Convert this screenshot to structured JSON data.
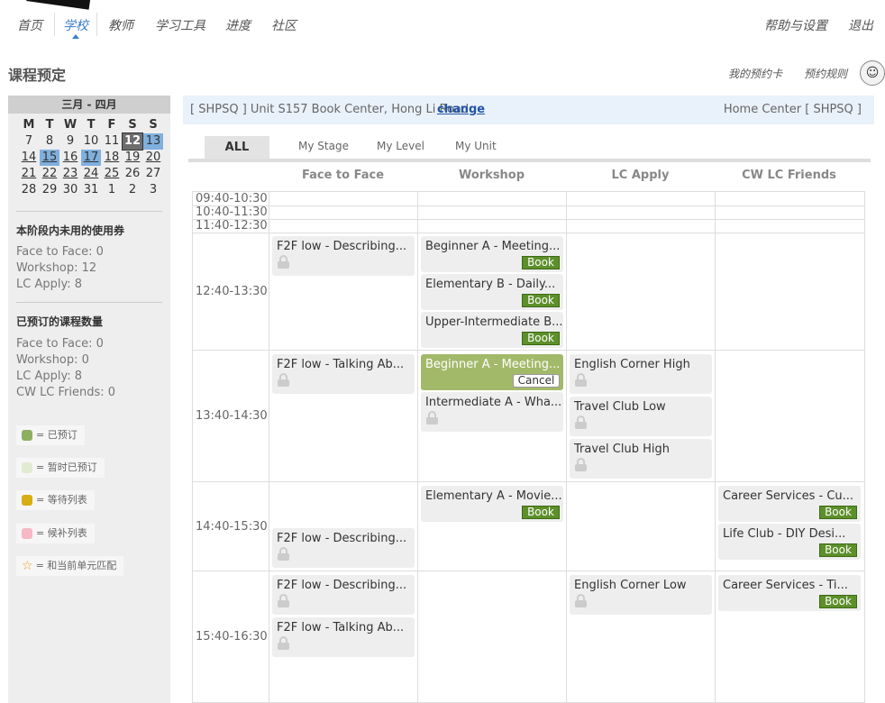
{
  "nav": {
    "items": [
      "首页",
      "学校",
      "教师",
      "学习工具",
      "进度",
      "社区"
    ],
    "help": "帮助与设置",
    "logout": "退出"
  },
  "page": {
    "title": "课程预定",
    "my_card": "我的预约卡",
    "rules": "预约规则"
  },
  "calendar": {
    "header": "三月 - 四月",
    "dows": [
      "M",
      "T",
      "W",
      "T",
      "F",
      "S",
      "S"
    ],
    "rows": [
      [
        "7",
        "8",
        "9",
        "10",
        "11",
        "12",
        "13"
      ],
      [
        "14",
        "15",
        "16",
        "17",
        "18",
        "19",
        "20"
      ],
      [
        "21",
        "22",
        "23",
        "24",
        "25",
        "26",
        "27"
      ],
      [
        "28",
        "29",
        "30",
        "31",
        "1",
        "2",
        "3"
      ]
    ]
  },
  "sidebar": {
    "unused_title": "本阶段内未用的使用券",
    "unused": [
      "Face to Face: 0",
      "Workshop: 12",
      "LC Apply: 8"
    ],
    "booked_title": "已预订的课程数量",
    "booked": [
      "Face to Face: 0",
      "Workshop: 0",
      "LC Apply: 8",
      "CW LC Friends: 0"
    ],
    "legend": [
      "= 已预订",
      "= 暂时已预订",
      "= 等待列表",
      "= 候补列表",
      "= 和当前单元匹配"
    ],
    "legend_colors": [
      "#8db060",
      "#e2ead2",
      "#d8ac14",
      "#f5b8c4",
      "#e8a020"
    ]
  },
  "center": {
    "name": "[ SHPSQ ]  Unit S157 Book Center, Hong Li Road",
    "change": "change",
    "home": "Home Center [ SHPSQ ]"
  },
  "tabs": [
    "ALL",
    "My Stage",
    "My Level",
    "My Unit"
  ],
  "columns": [
    "Face to Face",
    "Workshop",
    "LC Apply",
    "CW LC Friends"
  ],
  "slots": [
    "09:40-10:30",
    "10:40-11:30",
    "11:40-12:30",
    "12:40-13:30",
    "13:40-14:30",
    "14:40-15:30",
    "15:40-16:30"
  ],
  "cards": {
    "f2f_1": "F2F low - Describing...",
    "ws_1": "Beginner A - Meeting...",
    "ws_2": "Elementary B - Daily...",
    "ws_3": "Upper-Intermediate B...",
    "f2f_2": "F2F low - Talking Ab...",
    "ws_4": "Beginner A - Meeting...",
    "ws_5": "Intermediate A - Wha...",
    "lc_1": "English Corner High",
    "lc_2": "Travel Club Low",
    "lc_3": "Travel Club High",
    "ws_6": "Elementary A - Movie...",
    "cw_1": "Career Services - Cu...",
    "cw_2": "Life Club - DIY Desi...",
    "f2f_3": "F2F low - Describing...",
    "f2f_4": "F2F low - Describing...",
    "f2f_5": "F2F low - Talking Ab...",
    "lc_4": "English Corner Low",
    "cw_3": "Career Services - Ti..."
  },
  "buttons": {
    "book": "Book",
    "cancel": "Cancel"
  }
}
